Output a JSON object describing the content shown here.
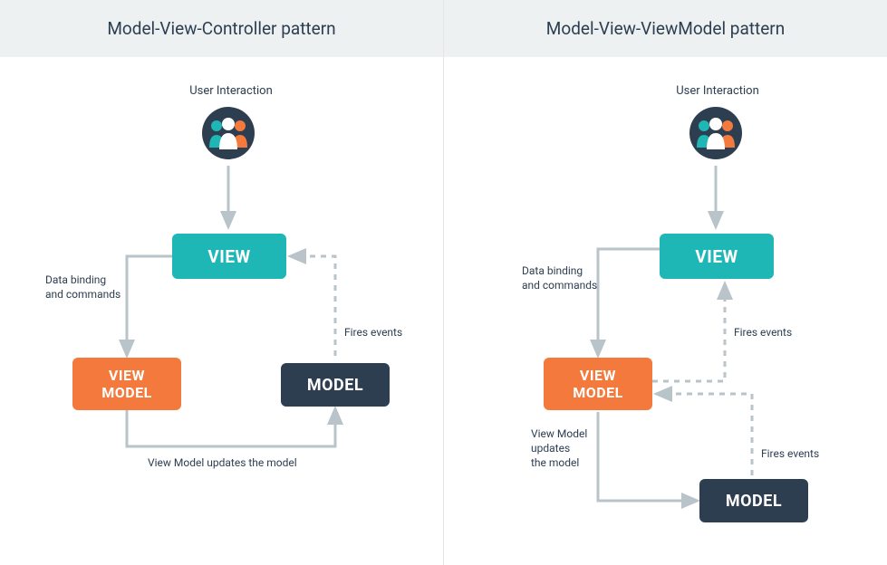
{
  "left": {
    "title": "Model-View-Controller pattern",
    "userLabel": "User Interaction",
    "view": "VIEW",
    "viewModel": "VIEW\nMODEL",
    "model": "MODEL",
    "databinding": "Data binding\nand commands",
    "firesEvents": "Fires events",
    "vmUpdates": "View Model updates the model"
  },
  "right": {
    "title": "Model-View-ViewModel pattern",
    "userLabel": "User Interaction",
    "view": "VIEW",
    "viewModel": "VIEW\nMODEL",
    "model": "MODEL",
    "databinding": "Data binding\nand commands",
    "firesEvents1": "Fires events",
    "firesEvents2": "Fires events",
    "vmUpdates": "View Model\nupdates\nthe model"
  },
  "colors": {
    "teal": "#1fb6b6",
    "orange": "#f37a3c",
    "dark": "#2c3e50",
    "line": "#b8c4ca",
    "headerBg": "#eef1f2"
  }
}
